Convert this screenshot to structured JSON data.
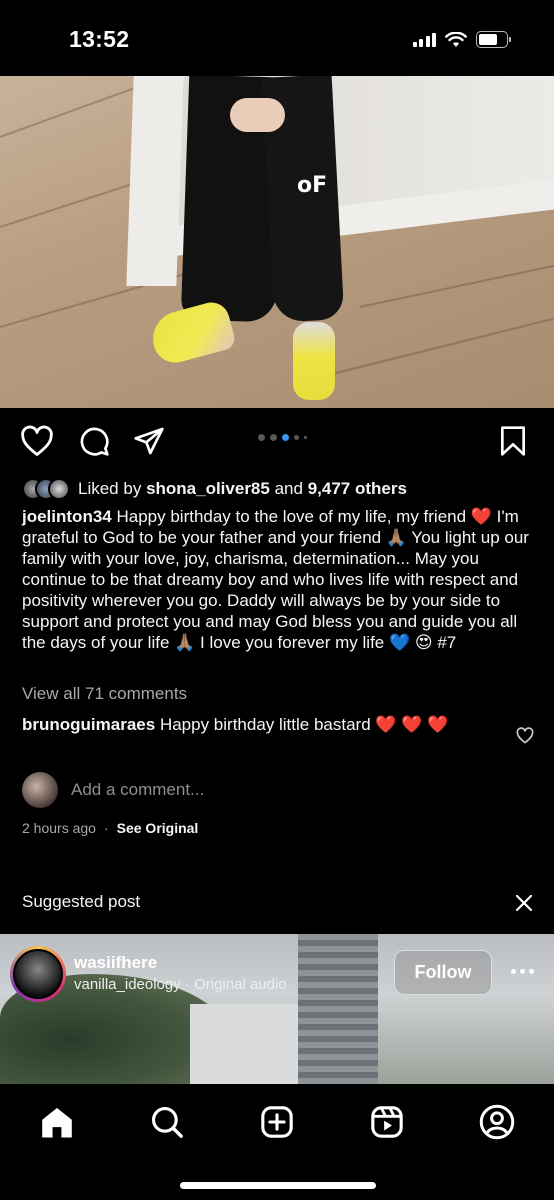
{
  "status_bar": {
    "time": "13:52",
    "icons": [
      "signal-icon",
      "wifi-icon",
      "battery-icon"
    ]
  },
  "post": {
    "carousel": {
      "dots": 5,
      "active_index": 2
    },
    "liked_by_prefix": "Liked by",
    "liked_by_user": "shona_oliver85",
    "liked_and": "and",
    "liked_others": "9,477 others",
    "caption_user": "joelinton34",
    "caption_text": "Happy birthday to the love of my life, my friend ❤️ I'm grateful to God to be your father and your friend 🙏🏽 You light up our family with your love, joy, charisma, determination... May you continue to be that dreamy boy and who lives life with respect and positivity wherever you go. Daddy will always be by your side to support and protect you and may God bless you and guide you all the days of your life 🙏🏽 I love you forever my life 💙 😍 #7",
    "view_all_comments": "View all 71 comments",
    "comment_user": "brunoguimaraes",
    "comment_text": "Happy birthday little bastard ❤️ ❤️ ❤️",
    "add_comment_placeholder": "Add a comment...",
    "time_ago": "2 hours ago",
    "separator": "·",
    "see_original": "See Original"
  },
  "suggested": {
    "label": "Suggested post",
    "username": "wasiifhere",
    "audio": "vanilla_ideology · Original audio",
    "follow_label": "Follow"
  },
  "tabs": [
    "home-icon",
    "search-icon",
    "create-icon",
    "reels-icon",
    "profile-icon"
  ],
  "colors": {
    "background": "#000000",
    "text": "#f5f5f5",
    "muted": "#a8a8a8",
    "carousel_active": "#3897f0"
  }
}
